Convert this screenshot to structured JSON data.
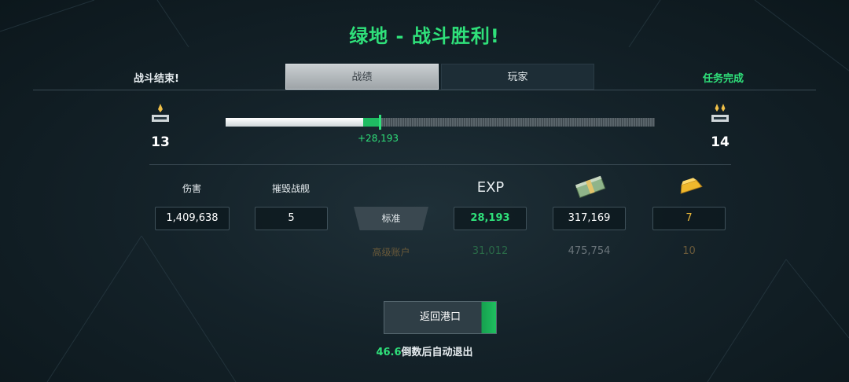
{
  "title": "绿地 - 战斗胜利!",
  "header": {
    "left_text": "战斗结束!",
    "right_text": "任务完成",
    "tabs": [
      {
        "label": "战绩",
        "active": true
      },
      {
        "label": "玩家",
        "active": false
      }
    ]
  },
  "rank": {
    "current": "13",
    "next": "14",
    "progress_base_fraction": 0.32,
    "progress_total_fraction": 0.36,
    "gain_label": "+28,193"
  },
  "stats": {
    "damage_label": "伤害",
    "damage_value": "1,409,638",
    "kills_label": "摧毁战舰",
    "kills_value": "5",
    "exp_label": "EXP",
    "standard_label": "标准",
    "exp_value": "28,193",
    "credits_value": "317,169",
    "gold_value": "7",
    "premium_label": "高级账户",
    "premium_exp": "31,012",
    "premium_credits": "475,754",
    "premium_gold": "10"
  },
  "footer": {
    "return_button": "返回港口",
    "countdown_value": "46.6",
    "countdown_text": "倒数后自动退出"
  },
  "colors": {
    "accent_green": "#2fe07a",
    "gold": "#e8b73a"
  },
  "icons": [
    "rank-insignia-icon",
    "money-stack-icon",
    "gold-bar-icon"
  ]
}
